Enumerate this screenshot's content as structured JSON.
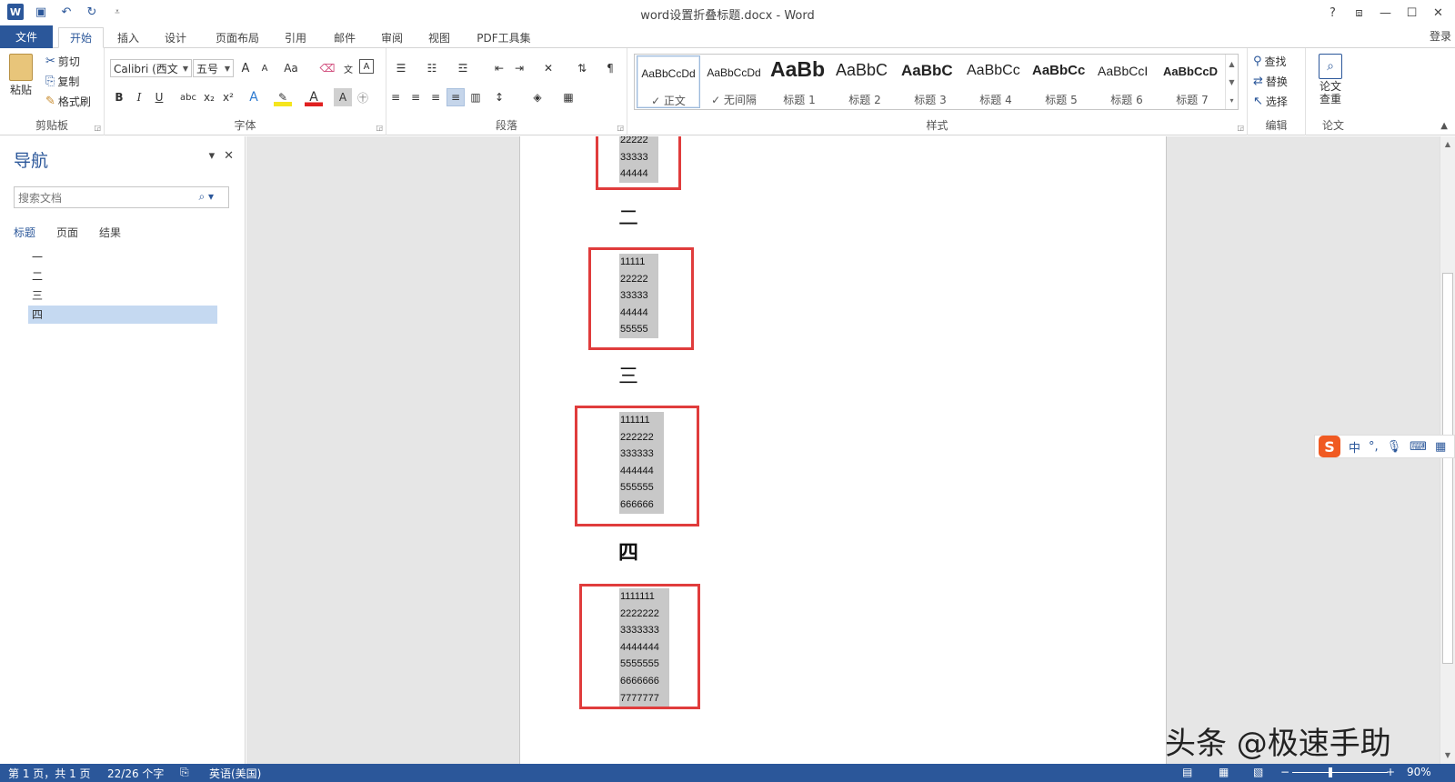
{
  "window": {
    "title": "word设置折叠标题.docx - Word",
    "controls": {
      "help": "?",
      "restore_ribbon": "⧈",
      "minimize": "—",
      "maximize": "☐",
      "close": "✕"
    }
  },
  "qat": {
    "save_icon": "save-icon",
    "undo": "↶",
    "redo": "↻",
    "customize": "⩡"
  },
  "tabs": {
    "file": "文件",
    "items": [
      "开始",
      "插入",
      "设计",
      "页面布局",
      "引用",
      "邮件",
      "审阅",
      "视图",
      "PDF工具集"
    ],
    "active": "开始",
    "login": "登录"
  },
  "ribbon": {
    "clipboard": {
      "paste": "粘贴",
      "cut": "剪切",
      "copy": "复制",
      "format_painter": "格式刷",
      "label": "剪贴板"
    },
    "font": {
      "font_name": "Calibri (西文",
      "font_size": "五号",
      "grow": "A",
      "shrink": "A",
      "case": "Aa",
      "bold": "B",
      "italic": "I",
      "underline": "U",
      "strike": "abc",
      "sub": "x₂",
      "sup": "x²",
      "label": "字体"
    },
    "paragraph": {
      "label": "段落"
    },
    "styles": {
      "label": "样式",
      "items": [
        {
          "preview": "AaBbCcDd",
          "name": "✓ 正文"
        },
        {
          "preview": "AaBbCcDd",
          "name": "✓ 无间隔"
        },
        {
          "preview": "AaBb",
          "name": "标题 1"
        },
        {
          "preview": "AaBbC",
          "name": "标题 2"
        },
        {
          "preview": "AaBbC",
          "name": "标题 3"
        },
        {
          "preview": "AaBbCc",
          "name": "标题 4"
        },
        {
          "preview": "AaBbCc",
          "name": "标题 5"
        },
        {
          "preview": "AaBbCcI",
          "name": "标题 6"
        },
        {
          "preview": "AaBbCcD",
          "name": "标题 7"
        }
      ]
    },
    "editing": {
      "find": "查找",
      "replace": "替换",
      "select": "选择",
      "label": "编辑"
    },
    "paper": {
      "check": "论文\n查重",
      "label": "论文"
    }
  },
  "nav": {
    "title": "导航",
    "search_placeholder": "搜索文档",
    "tabs": [
      "标题",
      "页面",
      "结果"
    ],
    "headings": [
      "一",
      "二",
      "三",
      "四"
    ],
    "selected": "四"
  },
  "document": {
    "block1": [
      "22222",
      "33333",
      "44444"
    ],
    "heading2": "二",
    "block2": [
      "11111",
      "22222",
      "33333",
      "44444",
      "55555"
    ],
    "heading3": "三",
    "block3": [
      "111111",
      "222222",
      "333333",
      "444444",
      "555555",
      "666666"
    ],
    "heading4": "四",
    "block4": [
      "1111111",
      "2222222",
      "3333333",
      "4444444",
      "5555555",
      "6666666",
      "7777777"
    ]
  },
  "ime": {
    "logo": "S",
    "mode": "中",
    "punct": "°,",
    "voice": "voice-icon",
    "keyboard": "keyboard-icon",
    "tools": "grid-icon"
  },
  "watermark": "头条 @极速手助",
  "status": {
    "page": "第 1 页，共 1 页",
    "words": "22/26 个字",
    "language": "英语(美国)",
    "zoom": "90%",
    "zoom_minus": "−",
    "zoom_plus": "+"
  },
  "colors": {
    "accent": "#2b579a",
    "highlight_box": "#e03c3c",
    "selection": "#c8c8c8"
  }
}
